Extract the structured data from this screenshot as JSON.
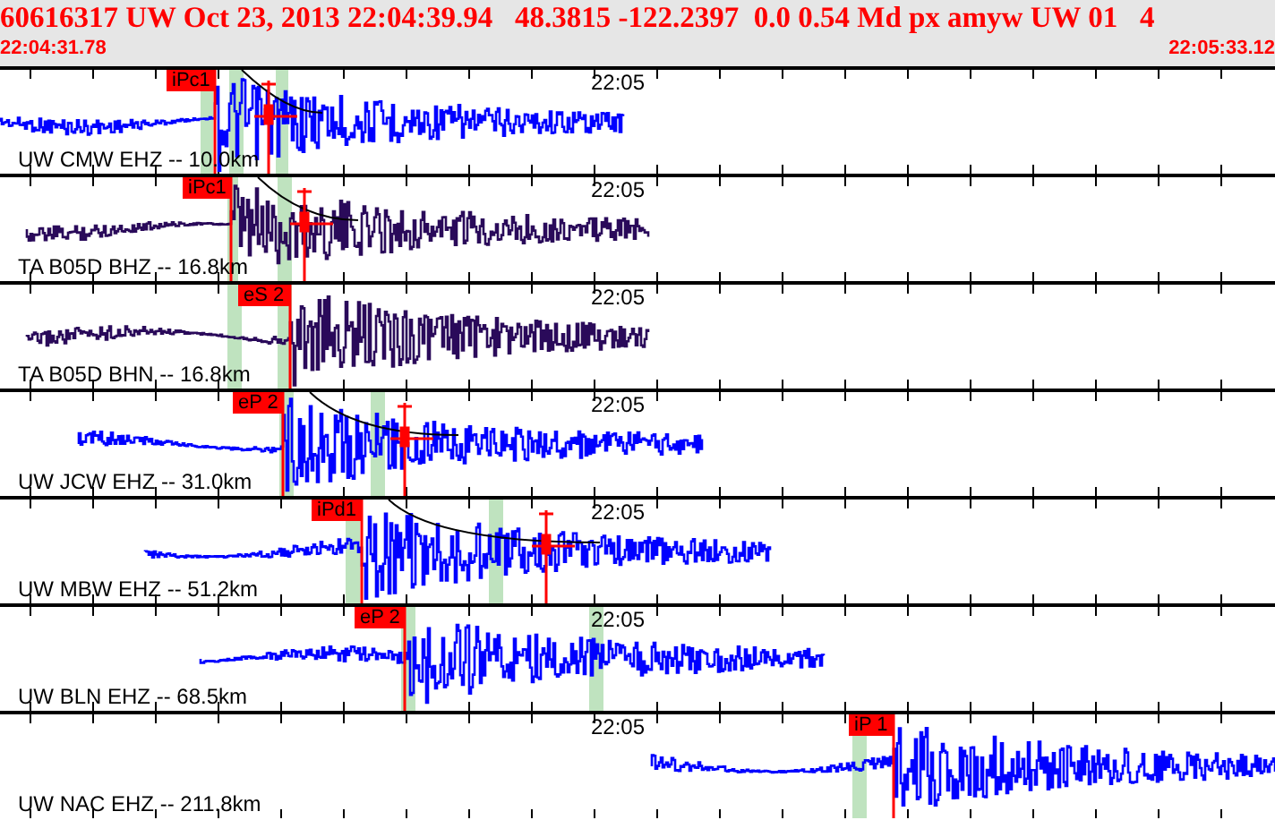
{
  "header": {
    "title": "60616317 UW Oct 23, 2013 22:04:39.94   48.3815 -122.2397  0.0 0.54 Md px amyw UW 01   4",
    "start_time": "22:04:31.78",
    "end_time": "22:05:33.12"
  },
  "traces": [
    {
      "label": "UW CMW EHZ -- 10.0km",
      "time_mark": "22:05",
      "pick": "iPc1",
      "color": "#0000ff"
    },
    {
      "label": "TA B05D BHZ -- 16.8km",
      "time_mark": "22:05",
      "pick": "iPc1",
      "color": "#2a0a5a"
    },
    {
      "label": "TA B05D BHN -- 16.8km",
      "time_mark": "22:05",
      "pick": "eS 2",
      "color": "#2a0a5a"
    },
    {
      "label": "UW JCW EHZ -- 31.0km",
      "time_mark": "22:05",
      "pick": "eP 2",
      "color": "#0000ff"
    },
    {
      "label": "UW MBW EHZ -- 51.2km",
      "time_mark": "22:05",
      "pick": "iPd1",
      "color": "#0000ff"
    },
    {
      "label": "UW BLN EHZ -- 68.5km",
      "time_mark": "22:05",
      "pick": "eP 2",
      "color": "#0000ff"
    },
    {
      "label": "UW NAC EHZ -- 211.8km",
      "time_mark": "22:05",
      "pick": "iP 1",
      "color": "#0000ff"
    }
  ]
}
